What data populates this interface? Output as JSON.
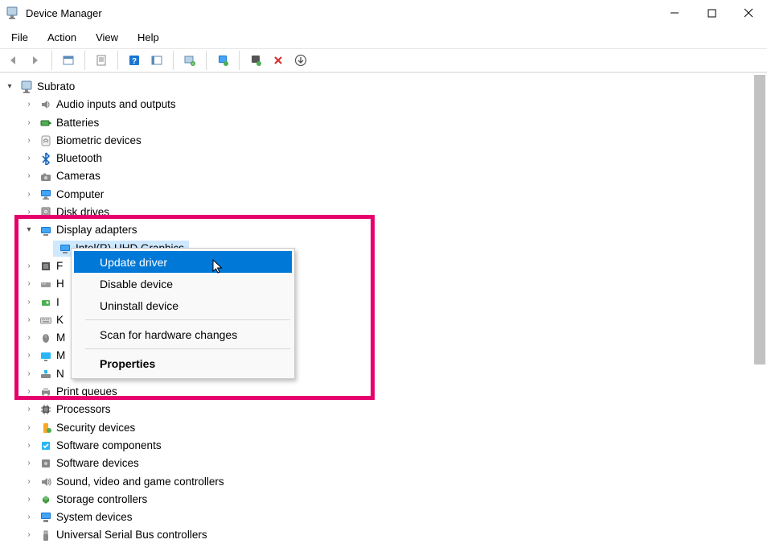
{
  "window": {
    "title": "Device Manager"
  },
  "menubar": [
    "File",
    "Action",
    "View",
    "Help"
  ],
  "tree": {
    "root": "Subrato",
    "categories": [
      {
        "label": "Audio inputs and outputs",
        "icon": "speaker",
        "expanded": false
      },
      {
        "label": "Batteries",
        "icon": "battery",
        "expanded": false
      },
      {
        "label": "Biometric devices",
        "icon": "fingerprint",
        "expanded": false
      },
      {
        "label": "Bluetooth",
        "icon": "bluetooth",
        "expanded": false
      },
      {
        "label": "Cameras",
        "icon": "camera",
        "expanded": false
      },
      {
        "label": "Computer",
        "icon": "computer",
        "expanded": false
      },
      {
        "label": "Disk drives",
        "icon": "disk",
        "expanded": false
      },
      {
        "label": "Display adapters",
        "icon": "display",
        "expanded": true,
        "selected_child": "Intel(R) UHD Graphics"
      },
      {
        "label": "F",
        "icon": "firmware",
        "expanded": false,
        "truncated": true
      },
      {
        "label": "H",
        "icon": "hid",
        "expanded": false,
        "truncated": true
      },
      {
        "label": "I",
        "icon": "imaging",
        "expanded": false,
        "truncated": true
      },
      {
        "label": "K",
        "icon": "keyboard",
        "expanded": false,
        "truncated": true
      },
      {
        "label": "M",
        "icon": "mouse",
        "expanded": false,
        "truncated": true
      },
      {
        "label": "M",
        "icon": "monitor",
        "expanded": false,
        "truncated": true
      },
      {
        "label": "N",
        "icon": "network",
        "expanded": false,
        "truncated": true
      },
      {
        "label": "Print queues",
        "icon": "printer",
        "expanded": false
      },
      {
        "label": "Processors",
        "icon": "cpu",
        "expanded": false
      },
      {
        "label": "Security devices",
        "icon": "security",
        "expanded": false
      },
      {
        "label": "Software components",
        "icon": "swcomp",
        "expanded": false
      },
      {
        "label": "Software devices",
        "icon": "swdev",
        "expanded": false
      },
      {
        "label": "Sound, video and game controllers",
        "icon": "sound",
        "expanded": false
      },
      {
        "label": "Storage controllers",
        "icon": "storage",
        "expanded": false
      },
      {
        "label": "System devices",
        "icon": "sysdev",
        "expanded": false
      },
      {
        "label": "Universal Serial Bus controllers",
        "icon": "usb",
        "expanded": false
      }
    ]
  },
  "context_menu": {
    "items": [
      {
        "label": "Update driver",
        "highlighted": true
      },
      {
        "label": "Disable device"
      },
      {
        "label": "Uninstall device"
      },
      {
        "separator": true
      },
      {
        "label": "Scan for hardware changes"
      },
      {
        "separator": true
      },
      {
        "label": "Properties",
        "bold": true
      }
    ]
  }
}
